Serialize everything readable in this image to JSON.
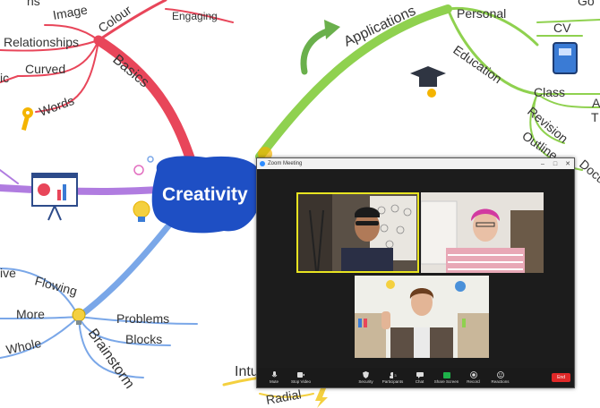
{
  "mindmap": {
    "center": "Creativity",
    "branches": {
      "basics": "Basics",
      "applications": "Applications",
      "brainstorm": "Brainstorm",
      "intuition_partial": "Intu",
      "radial_partial": "Radial"
    },
    "basics_children": [
      "Image",
      "Colour",
      "Engaging",
      "Relationships",
      "Curved",
      "Words",
      "ic",
      "ns"
    ],
    "applications_children": [
      "Personal",
      "CV",
      "Go",
      "Education",
      "Class",
      "Revision",
      "Outline",
      "Docu",
      "A",
      "T"
    ],
    "brainstorm_children": [
      "Flowing",
      "More",
      "Whole",
      "Problems",
      "Blocks",
      "ive"
    ]
  },
  "zoom": {
    "title": "Zoom Meeting",
    "window_controls": [
      "–",
      "□",
      "✕"
    ],
    "toolbar": {
      "mute": "Mute",
      "stop_video": "Stop Video",
      "security": "Security",
      "participants": "Participants",
      "participants_count": "3",
      "chat": "Chat",
      "share_screen": "Share Screen",
      "record": "Record",
      "reactions": "Reactions",
      "end": "End"
    }
  }
}
